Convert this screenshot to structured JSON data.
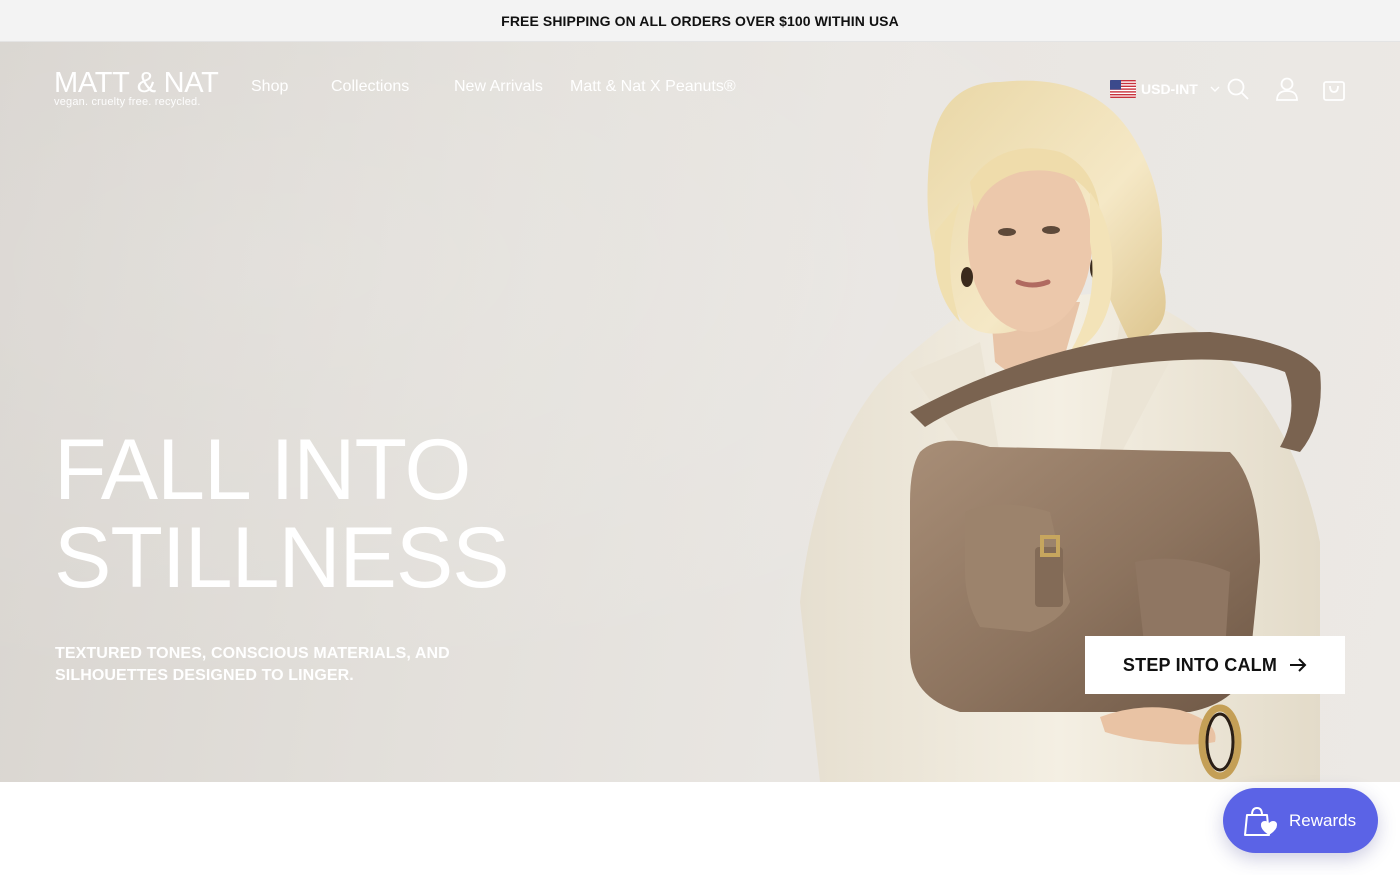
{
  "announcement": {
    "text": "FREE SHIPPING ON ALL ORDERS OVER $100 WITHIN USA"
  },
  "header": {
    "logo_name": "MATT & NAT",
    "logo_tagline": "vegan. cruelty free. recycled.",
    "nav": [
      {
        "label": "Shop"
      },
      {
        "label": "Collections"
      },
      {
        "label": "New Arrivals"
      },
      {
        "label": "Matt & Nat X Peanuts®"
      }
    ],
    "currency": {
      "label": "USD-INT",
      "flag_icon": "us-flag-icon"
    },
    "icons": [
      "search-icon",
      "account-icon",
      "cart-icon"
    ]
  },
  "hero": {
    "headline_line1": "FALL INTO",
    "headline_line2": "STILLNESS",
    "subcopy_line1": "TEXTURED TONES, CONSCIOUS MATERIALS, AND",
    "subcopy_line2": "SILHOUETTES DESIGNED TO LINGER.",
    "cta_label": "STEP INTO CALM",
    "cta_icon": "arrow-right-icon"
  },
  "rewards": {
    "label": "Rewards",
    "icon": "shopping-bag-heart-icon",
    "color": "#5b63e6"
  },
  "colors": {
    "announcement_bg": "#f3f3f3",
    "hero_text": "#ffffff",
    "cta_bg": "#ffffff",
    "bag": "#8e7560",
    "jacket": "#f1ece0"
  }
}
